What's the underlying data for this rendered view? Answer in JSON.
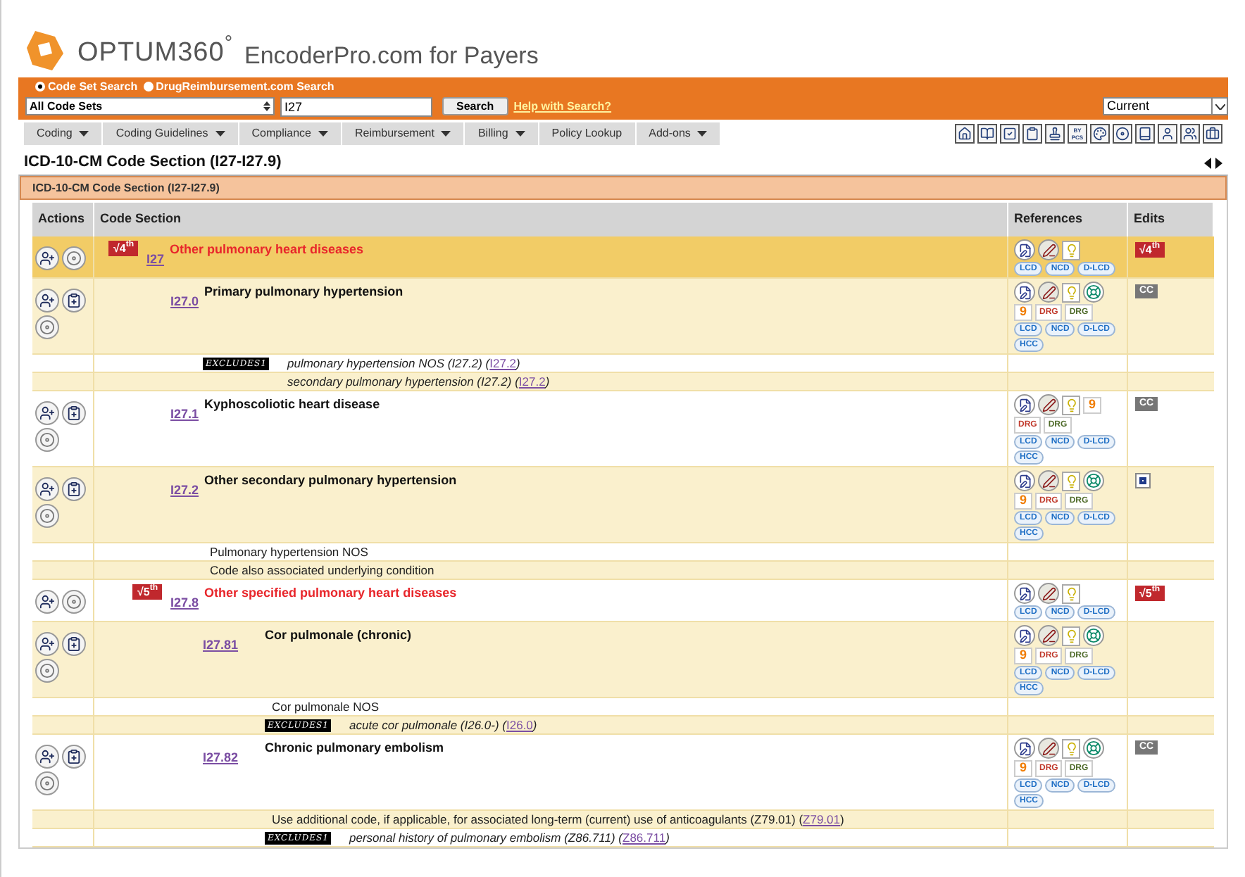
{
  "header": {
    "logo": "OPTUM360$^{°}$",
    "product": "EncoderPro.com for Payers"
  },
  "search": {
    "modes": [
      {
        "label": "Code Set Search",
        "selected": true
      },
      {
        "label": "DrugReimbursement.com Search",
        "selected": false
      }
    ],
    "code_set": "All Code Sets",
    "query": "I27",
    "button": "Search",
    "help": "Help with Search?",
    "version": "Current"
  },
  "menu": [
    {
      "label": "Coding",
      "dropdown": true
    },
    {
      "label": "Coding Guidelines",
      "dropdown": true
    },
    {
      "label": "Compliance",
      "dropdown": true
    },
    {
      "label": "Reimbursement",
      "dropdown": true
    },
    {
      "label": "Billing",
      "dropdown": true
    },
    {
      "label": "Policy Lookup",
      "dropdown": false
    },
    {
      "label": "Add-ons",
      "dropdown": true
    }
  ],
  "toolbar_label": "BY PCS",
  "page_title": "ICD-10-CM Code Section (I27-I27.9)",
  "panel_title": "ICD-10-CM Code Section (I27-I27.9)",
  "columns": [
    "Actions",
    "Code Section",
    "References",
    "Edits"
  ],
  "rows": [
    {
      "code": "I27",
      "title": "Other pulmonary heart diseases",
      "flag": "√4$^{th}$",
      "highlighted": true,
      "actions": [
        {
          "kind": "add"
        },
        {
          "kind": "disc"
        }
      ],
      "references": [
        [
          {
            "kind": "notes"
          },
          {
            "kind": "coding"
          },
          {
            "kind": "tip"
          }
        ],
        [
          {
            "kind": "pill",
            "text": "LCD"
          },
          {
            "kind": "pill",
            "text": "NCD"
          },
          {
            "kind": "pill",
            "text": "D-LCD"
          }
        ]
      ],
      "edit": {
        "kind": "flag",
        "text": "√4$^{th}$"
      },
      "children": [
        {
          "code": "I27.0",
          "title": "Primary pulmonary hypertension",
          "highlighted": false,
          "actions": [
            {
              "kind": "add"
            },
            {
              "kind": "clipboard"
            },
            {
              "kind": "disc"
            }
          ],
          "references": [
            [
              {
                "kind": "notes"
              },
              {
                "kind": "coding"
              },
              {
                "kind": "tip"
              },
              {
                "kind": "lifesaver"
              }
            ],
            [
              {
                "kind": "number",
                "text": "9"
              },
              {
                "kind": "drg",
                "text": "DRG",
                "color": "#c0392b"
              },
              {
                "kind": "drg",
                "text": "DRG",
                "color": "#4f6b2a"
              }
            ],
            [
              {
                "kind": "pill",
                "text": "LCD"
              },
              {
                "kind": "pill",
                "text": "NCD"
              },
              {
                "kind": "pill",
                "text": "D-LCD"
              }
            ],
            [
              {
                "kind": "pill",
                "text": "HCC"
              }
            ]
          ],
          "edit": {
            "kind": "cc",
            "text": "CC"
          },
          "notes": [
            {
              "kind": "excludes",
              "badge": "EXCLUDES1",
              "text": "pulmonary hypertension NOS (I27.2)  (",
              "link": "I27.2",
              "after": ")"
            },
            {
              "kind": "excludes",
              "text": "secondary pulmonary hypertension (I27.2)  (",
              "link": "I27.2",
              "after": ")"
            }
          ]
        },
        {
          "code": "I27.1",
          "title": "Kyphoscoliotic heart disease",
          "highlighted": false,
          "actions": [
            {
              "kind": "add"
            },
            {
              "kind": "clipboard"
            },
            {
              "kind": "disc"
            }
          ],
          "references": [
            [
              {
                "kind": "notes"
              },
              {
                "kind": "coding"
              },
              {
                "kind": "tip"
              },
              {
                "kind": "number",
                "text": "9"
              }
            ],
            [
              {
                "kind": "drg",
                "text": "DRG",
                "color": "#c0392b"
              },
              {
                "kind": "drg",
                "text": "DRG",
                "color": "#4f6b2a"
              }
            ],
            [
              {
                "kind": "pill",
                "text": "LCD"
              },
              {
                "kind": "pill",
                "text": "NCD"
              },
              {
                "kind": "pill",
                "text": "D-LCD"
              }
            ],
            [
              {
                "kind": "pill",
                "text": "HCC"
              }
            ]
          ],
          "edit": {
            "kind": "cc",
            "text": "CC"
          }
        },
        {
          "code": "I27.2",
          "title": "Other secondary pulmonary hypertension",
          "highlighted": false,
          "actions": [
            {
              "kind": "add"
            },
            {
              "kind": "clipboard"
            },
            {
              "kind": "disc"
            }
          ],
          "references": [
            [
              {
                "kind": "notes"
              },
              {
                "kind": "coding"
              },
              {
                "kind": "tip"
              },
              {
                "kind": "lifesaver"
              }
            ],
            [
              {
                "kind": "number",
                "text": "9"
              },
              {
                "kind": "drg",
                "text": "DRG",
                "color": "#c0392b"
              },
              {
                "kind": "drg",
                "text": "DRG",
                "color": "#4f6b2a"
              }
            ],
            [
              {
                "kind": "pill",
                "text": "LCD"
              },
              {
                "kind": "pill",
                "text": "NCD"
              },
              {
                "kind": "pill",
                "text": "D-LCD"
              }
            ],
            [
              {
                "kind": "pill",
                "text": "HCC"
              }
            ]
          ],
          "edit": {
            "kind": "box"
          },
          "notes": [
            {
              "kind": "note",
              "text": "Pulmonary hypertension NOS"
            },
            {
              "kind": "note",
              "text": "Code also associated underlying condition"
            }
          ]
        },
        {
          "code": "I27.8",
          "title": "Other specified pulmonary heart diseases",
          "flag": "√5$^{th}$",
          "highlighted": false,
          "actions": [
            {
              "kind": "add"
            },
            {
              "kind": "disc"
            }
          ],
          "references": [
            [
              {
                "kind": "notes"
              },
              {
                "kind": "coding"
              },
              {
                "kind": "tip"
              }
            ],
            [
              {
                "kind": "pill",
                "text": "LCD"
              },
              {
                "kind": "pill",
                "text": "NCD"
              },
              {
                "kind": "pill",
                "text": "D-LCD"
              }
            ]
          ],
          "edit": {
            "kind": "flag",
            "text": "√5$^{th}$"
          },
          "children": [
            {
              "code": "I27.81",
              "title": "Cor pulmonale (chronic)",
              "highlighted": false,
              "actions": [
                {
                  "kind": "add"
                },
                {
                  "kind": "clipboard"
                },
                {
                  "kind": "disc"
                }
              ],
              "references": [
                [
                  {
                    "kind": "notes"
                  },
                  {
                    "kind": "coding"
                  },
                  {
                    "kind": "tip"
                  },
                  {
                    "kind": "lifesaver"
                  }
                ],
                [
                  {
                    "kind": "number",
                    "text": "9"
                  },
                  {
                    "kind": "drg",
                    "text": "DRG",
                    "color": "#c0392b"
                  },
                  {
                    "kind": "drg",
                    "text": "DRG",
                    "color": "#4f6b2a"
                  }
                ],
                [
                  {
                    "kind": "pill",
                    "text": "LCD"
                  },
                  {
                    "kind": "pill",
                    "text": "NCD"
                  },
                  {
                    "kind": "pill",
                    "text": "D-LCD"
                  }
                ],
                [
                  {
                    "kind": "pill",
                    "text": "HCC"
                  }
                ]
              ],
              "notes": [
                {
                  "kind": "note",
                  "text": "Cor pulmonale NOS"
                },
                {
                  "kind": "excludes",
                  "badge": "EXCLUDES1",
                  "text": "acute cor pulmonale (I26.0-)  (",
                  "link": "I26.0",
                  "after": ")"
                }
              ]
            },
            {
              "code": "I27.82",
              "title": "Chronic pulmonary embolism",
              "highlighted": false,
              "actions": [
                {
                  "kind": "add"
                },
                {
                  "kind": "clipboard"
                },
                {
                  "kind": "disc"
                }
              ],
              "references": [
                [
                  {
                    "kind": "notes"
                  },
                  {
                    "kind": "coding"
                  },
                  {
                    "kind": "tip"
                  },
                  {
                    "kind": "lifesaver"
                  }
                ],
                [
                  {
                    "kind": "number",
                    "text": "9"
                  },
                  {
                    "kind": "drg",
                    "text": "DRG",
                    "color": "#c0392b"
                  },
                  {
                    "kind": "drg",
                    "text": "DRG",
                    "color": "#4f6b2a"
                  }
                ],
                [
                  {
                    "kind": "pill",
                    "text": "LCD"
                  },
                  {
                    "kind": "pill",
                    "text": "NCD"
                  },
                  {
                    "kind": "pill",
                    "text": "D-LCD"
                  }
                ],
                [
                  {
                    "kind": "pill",
                    "text": "HCC"
                  }
                ]
              ],
              "edit": {
                "kind": "cc",
                "text": "CC"
              },
              "notes": [
                {
                  "kind": "note",
                  "text": "Use additional code, if applicable, for associated long-term (current) use of anticoagulants (Z79.01)  (",
                  "link": "Z79.01",
                  "after": ")"
                },
                {
                  "kind": "excludes",
                  "badge": "EXCLUDES1",
                  "text": "personal history of pulmonary embolism (Z86.711)  (",
                  "link": "Z86.711",
                  "after": ")"
                }
              ]
            }
          ]
        }
      ]
    }
  ]
}
